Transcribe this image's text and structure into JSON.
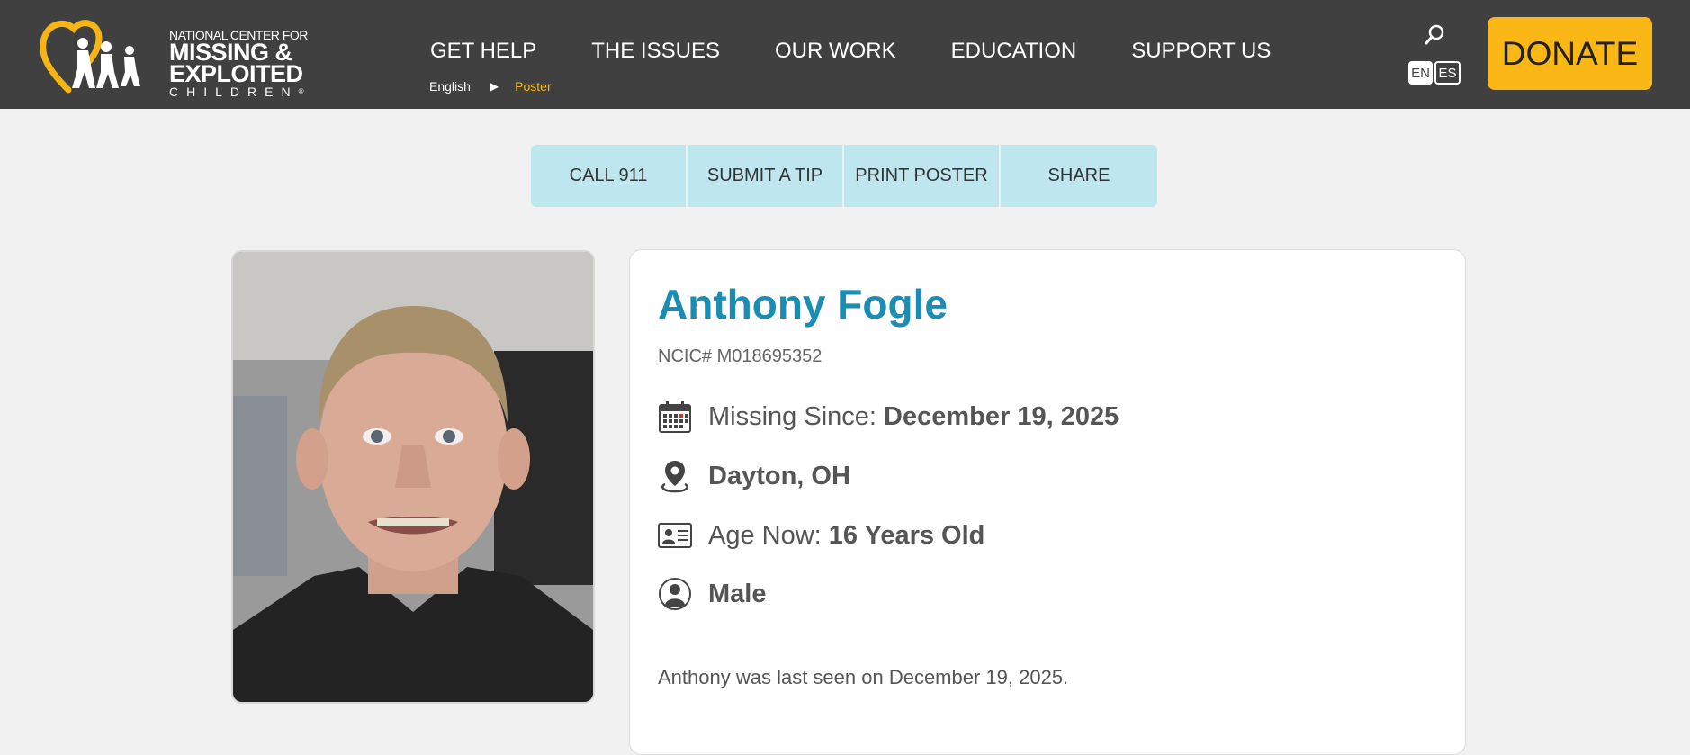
{
  "logo": {
    "line1": "NATIONAL CENTER FOR",
    "line2": "MISSING &",
    "line3": "EXPLOITED",
    "line4": "CHILDREN",
    "reg": "®"
  },
  "nav": {
    "items": [
      "GET HELP",
      "THE ISSUES",
      "OUR WORK",
      "EDUCATION",
      "SUPPORT US"
    ]
  },
  "breadcrumb": {
    "language": "English",
    "current": "Poster"
  },
  "lang_toggle": {
    "en": "EN",
    "es": "ES"
  },
  "donate_label": "DONATE",
  "actions": [
    "CALL 911",
    "SUBMIT A TIP",
    "PRINT POSTER",
    "SHARE"
  ],
  "person": {
    "name": "Anthony Fogle",
    "ncic": "NCIC# M018695352",
    "missing_label": "Missing Since:",
    "missing_date": "December 19, 2025",
    "location": "Dayton, OH",
    "age_label": "Age Now:",
    "age_value": "16 Years Old",
    "sex": "Male",
    "description": "Anthony was last seen on December 19, 2025."
  },
  "colors": {
    "header": "#404040",
    "accent": "#fbb715",
    "name": "#1b8db5",
    "action_bg": "#bde6ee"
  },
  "icons": [
    "heart-logo-icon",
    "search-icon",
    "calendar-icon",
    "location-pin-icon",
    "id-card-icon",
    "person-icon"
  ]
}
